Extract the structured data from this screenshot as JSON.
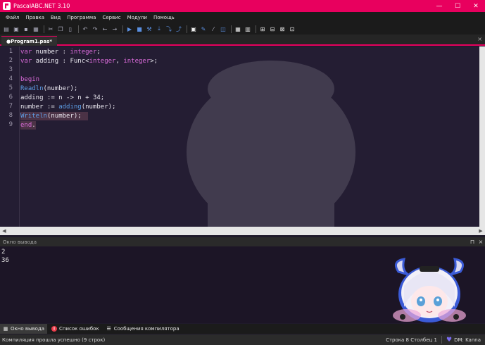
{
  "window": {
    "title": "PascalABC.NET 3.10",
    "minimize": "—",
    "maximize": "☐",
    "close": "✕"
  },
  "menu": [
    "Файл",
    "Правка",
    "Вид",
    "Программа",
    "Сервис",
    "Модули",
    "Помощь"
  ],
  "editor": {
    "tab_label": "●Program1.pas*",
    "tab_close": "×",
    "line_numbers": [
      "1",
      "2",
      "3",
      "4",
      "5",
      "6",
      "7",
      "8",
      "9"
    ],
    "lines": [
      "var number : integer;",
      "var adding : Func<integer, integer>;",
      "",
      "begin",
      "Readln(number);",
      "adding := n -> n + 34;",
      "number := adding(number);",
      "Writeln(number);",
      "end."
    ]
  },
  "output_panel": {
    "title": "Окно вывода",
    "pin": "⊓",
    "close": "×",
    "lines": [
      "2",
      "36"
    ]
  },
  "bottom_tabs": [
    {
      "label": "Окно вывода",
      "active": true
    },
    {
      "label": "Список ошибок",
      "active": false
    },
    {
      "label": "Сообщения компилятора",
      "active": false
    }
  ],
  "status": {
    "message": "Компиляция прошла успешно (9 строк)",
    "position": "Строка  8  Столбец  1",
    "dm": "DM: Kanna"
  },
  "colors": {
    "accent": "#e8005e",
    "keyword": "#d86ad8",
    "function": "#5d9ee6",
    "editor_bg": "#241d33"
  }
}
